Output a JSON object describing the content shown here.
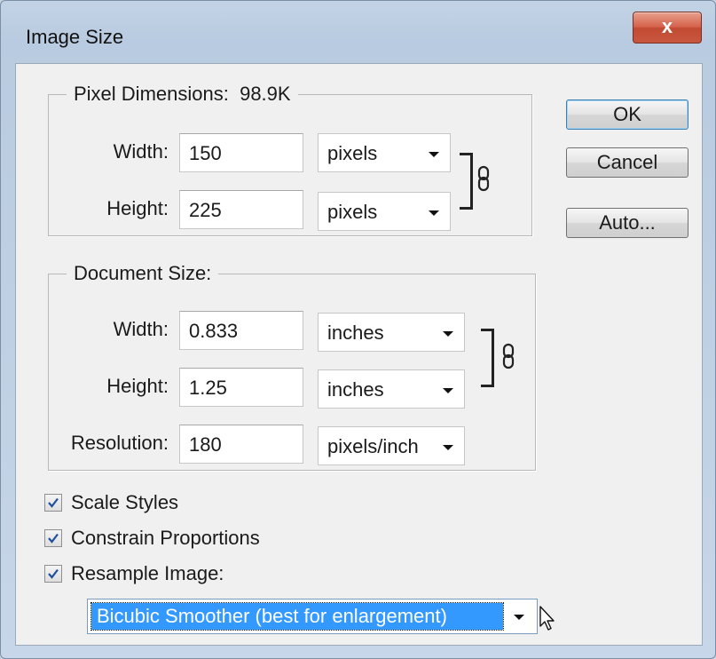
{
  "dialog": {
    "title": "Image Size",
    "close_label": "x"
  },
  "pixel_dimensions": {
    "legend": "Pixel Dimensions:",
    "size": "98.9K",
    "width_label": "Width:",
    "width_value": "150",
    "width_unit": "pixels",
    "height_label": "Height:",
    "height_value": "225",
    "height_unit": "pixels"
  },
  "document_size": {
    "legend": "Document Size:",
    "width_label": "Width:",
    "width_value": "0.833",
    "width_unit": "inches",
    "height_label": "Height:",
    "height_value": "1.25",
    "height_unit": "inches",
    "resolution_label": "Resolution:",
    "resolution_value": "180",
    "resolution_unit": "pixels/inch"
  },
  "buttons": {
    "ok": "OK",
    "cancel": "Cancel",
    "auto": "Auto..."
  },
  "options": {
    "scale_styles": {
      "label": "Scale Styles",
      "checked": true
    },
    "constrain_proportions": {
      "label": "Constrain Proportions",
      "checked": true
    },
    "resample_image": {
      "label": "Resample Image:",
      "checked": true
    }
  },
  "resample_method": "Bicubic Smoother (best for enlargement)",
  "colors": {
    "selection": "#3399ff",
    "close_button": "#c9573f"
  }
}
